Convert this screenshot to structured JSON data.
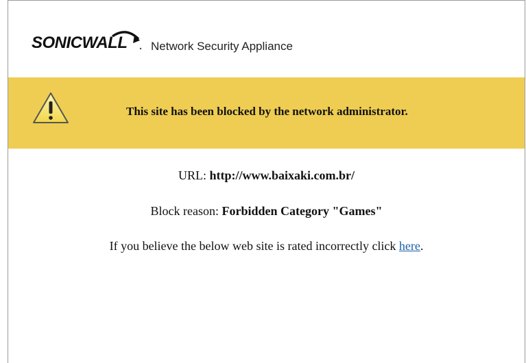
{
  "header": {
    "logo_text": "SONICWALL",
    "product_name": "Network Security Appliance"
  },
  "banner": {
    "icon": "warning-triangle-icon",
    "message": "This site has been blocked by the network administrator.",
    "color": "#efcd52"
  },
  "details": {
    "url_label": "URL: ",
    "url_value": "http://www.baixaki.com.br/",
    "reason_label": "Block reason: ",
    "reason_value": "Forbidden Category \"Games\"",
    "appeal_text": "If you believe the below web site is rated incorrectly click ",
    "appeal_link": "here",
    "appeal_end": "."
  },
  "colors": {
    "link": "#1a5fa8"
  }
}
